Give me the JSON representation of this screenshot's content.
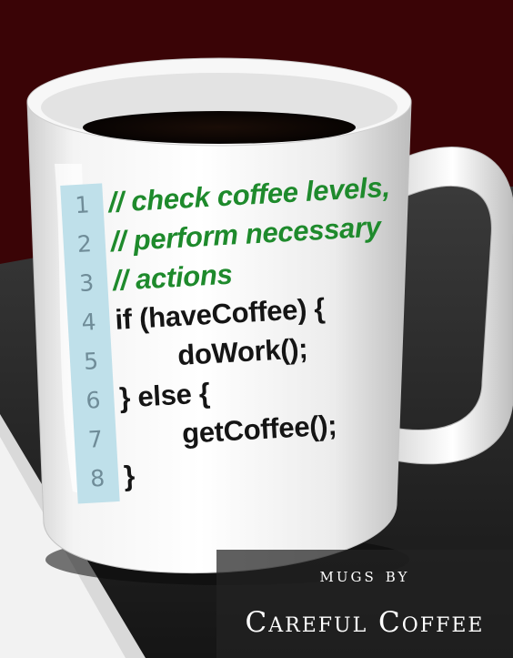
{
  "code": {
    "line_numbers": [
      "1",
      "2",
      "3",
      "4",
      "5",
      "6",
      "7",
      "8"
    ],
    "lines": [
      {
        "text": "// check coffee levels,",
        "kind": "comment"
      },
      {
        "text": "// perform necessary",
        "kind": "comment"
      },
      {
        "text": "// actions",
        "kind": "comment"
      },
      {
        "text": "if (haveCoffee) {",
        "kind": "code"
      },
      {
        "text": "        doWork();",
        "kind": "code"
      },
      {
        "text": "} else {",
        "kind": "code"
      },
      {
        "text": "        getCoffee();",
        "kind": "code"
      },
      {
        "text": "}",
        "kind": "code"
      }
    ]
  },
  "branding": {
    "line1": "mugs by",
    "line2": "Careful Coffee"
  },
  "colors": {
    "background": "#3a0406",
    "comment": "#1e8a2c",
    "code": "#151515",
    "gutter": "#bfe0ea",
    "line_number": "#6f8c98"
  }
}
